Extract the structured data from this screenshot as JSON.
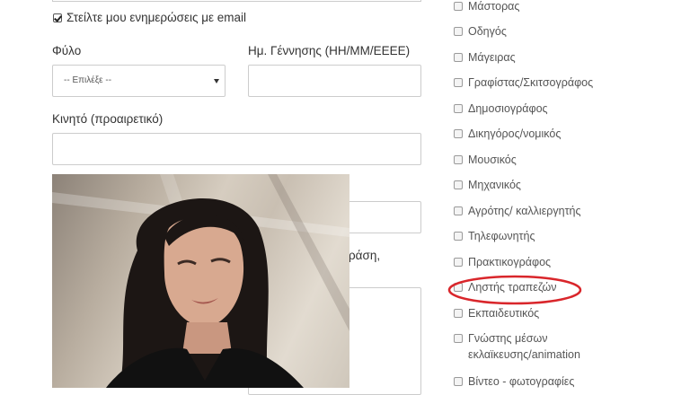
{
  "form": {
    "email_updates_label": "Στείλτε μου ενημερώσεις με email",
    "email_updates_checked": true,
    "gender_label": "Φύλο",
    "gender_select_value": "-- Επιλέξε --",
    "birthdate_label": "Ημ. Γέννησης (ΗΗ/ΜΜ/ΕΕΕΕ)",
    "birthdate_value": "",
    "mobile_label": "Κινητό (προαιρετικό)",
    "mobile_value": "",
    "partial_text_behind_photo": "ράση,"
  },
  "occupations": [
    {
      "label": "Μάστορας",
      "checked": false
    },
    {
      "label": "Οδηγός",
      "checked": false
    },
    {
      "label": "Μάγειρας",
      "checked": false
    },
    {
      "label": "Γραφίστας/Σκιτσογράφος",
      "checked": false
    },
    {
      "label": "Δημοσιογράφος",
      "checked": false
    },
    {
      "label": "Δικηγόρος/νομικός",
      "checked": false
    },
    {
      "label": "Μουσικός",
      "checked": false
    },
    {
      "label": "Μηχανικός",
      "checked": false
    },
    {
      "label": "Αγρότης/ καλλιεργητής",
      "checked": false
    },
    {
      "label": "Τηλεφωνητής",
      "checked": false
    },
    {
      "label": "Πρακτικογράφος",
      "checked": false
    },
    {
      "label": "Ληστής τραπεζών",
      "checked": false,
      "highlighted": true
    },
    {
      "label": "Εκπαιδευτικός",
      "checked": false
    },
    {
      "label_line1": "Γνώστης μέσων",
      "label_line2": "εκλαϊκευσης/animation",
      "checked": false
    },
    {
      "label": "Βίντεο - φωτογραφίες",
      "checked": false
    }
  ],
  "colors": {
    "highlight_ellipse": "#d9262b",
    "input_border": "#cccccc"
  }
}
